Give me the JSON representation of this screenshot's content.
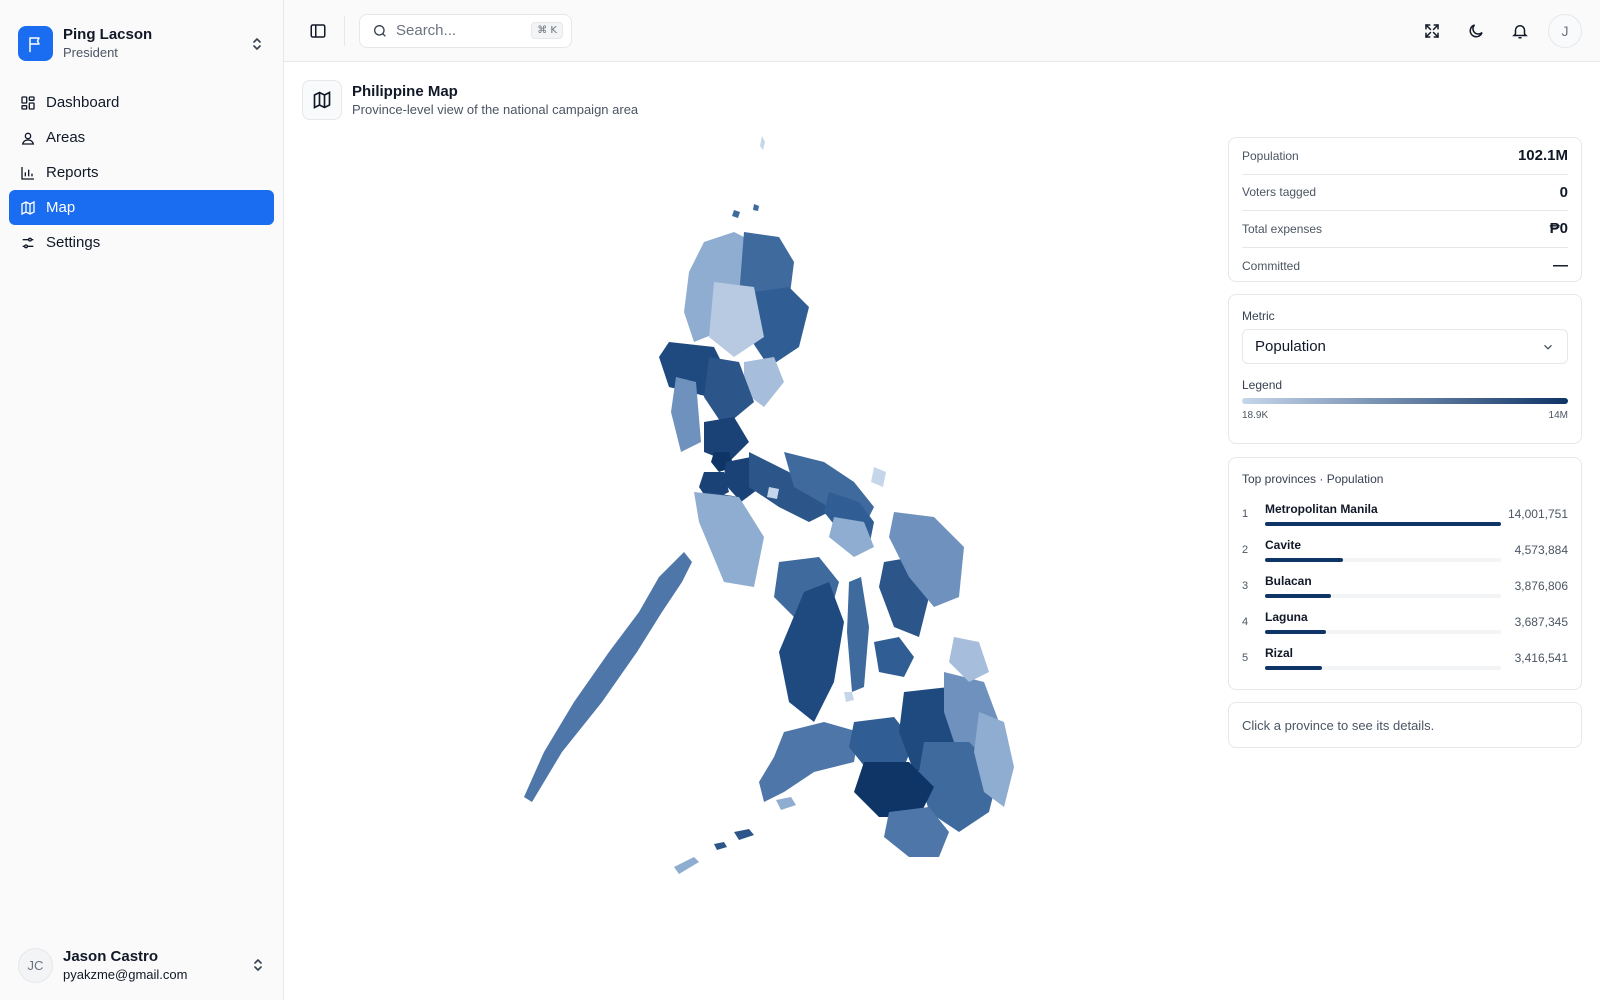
{
  "org": {
    "name": "Ping Lacson",
    "role": "President"
  },
  "nav": {
    "items": [
      {
        "label": "Dashboard",
        "icon": "dashboard-icon"
      },
      {
        "label": "Areas",
        "icon": "areas-icon"
      },
      {
        "label": "Reports",
        "icon": "reports-icon"
      },
      {
        "label": "Map",
        "icon": "map-icon",
        "active": true
      },
      {
        "label": "Settings",
        "icon": "settings-icon"
      }
    ]
  },
  "user": {
    "initials": "JC",
    "name": "Jason Castro",
    "email": "pyakzme@gmail.com"
  },
  "topbar": {
    "search_placeholder": "Search...",
    "shortcut": "⌘ K",
    "avatar_initial": "J"
  },
  "page": {
    "title": "Philippine Map",
    "subtitle": "Province-level view of the national campaign area"
  },
  "stats": [
    {
      "label": "Population",
      "value": "102.1M"
    },
    {
      "label": "Voters tagged",
      "value": "0"
    },
    {
      "label": "Total expenses",
      "value": "₱0"
    },
    {
      "label": "Committed",
      "value": "—"
    }
  ],
  "metric": {
    "label": "Metric",
    "selected": "Population",
    "legend_label": "Legend",
    "legend_min": "18.9K",
    "legend_max": "14M",
    "colors": {
      "low": "#c6d6ea",
      "high": "#0f3466"
    }
  },
  "top_provinces": {
    "title": "Top provinces · Population",
    "items": [
      {
        "rank": "1",
        "name": "Metropolitan Manila",
        "value": "14,001,751",
        "fraction": 1.0
      },
      {
        "rank": "2",
        "name": "Cavite",
        "value": "4,573,884",
        "fraction": 0.33
      },
      {
        "rank": "3",
        "name": "Bulacan",
        "value": "3,876,806",
        "fraction": 0.28
      },
      {
        "rank": "4",
        "name": "Laguna",
        "value": "3,687,345",
        "fraction": 0.26
      },
      {
        "rank": "5",
        "name": "Rizal",
        "value": "3,416,541",
        "fraction": 0.24
      }
    ]
  },
  "hint": "Click a province to see its details.",
  "accent": "#1a6cf0"
}
